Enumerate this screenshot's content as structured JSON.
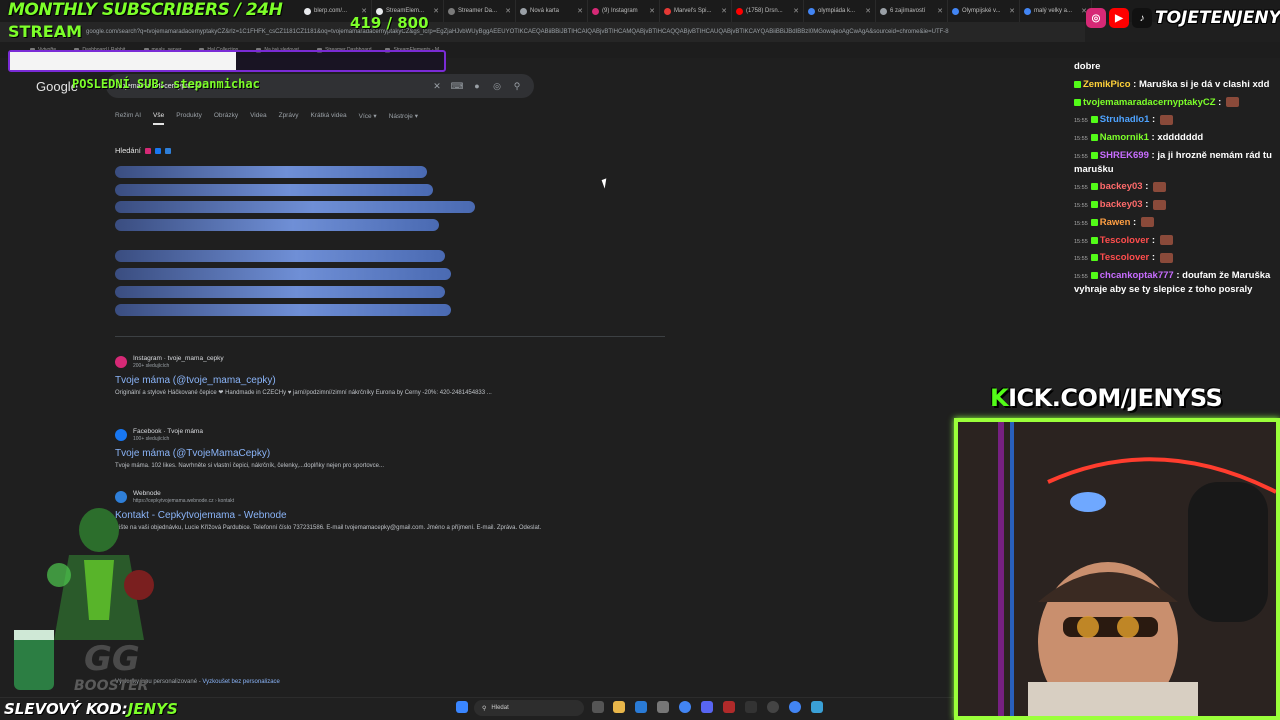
{
  "overlay": {
    "title": "MONTHLY SUBSCRIBERS / 24H",
    "stream": "STREAM",
    "count": "419  / 800",
    "progress_fraction": 0.52,
    "last_sub": "POSLEDNÍ SUB:  stepanmichac",
    "kick": "ICK.COM/JENYSS",
    "kick_k": "K",
    "handle": "TOJETENJENYS",
    "coupon_label": "SLEVOVÝ KOD:",
    "coupon_code": "JENYS"
  },
  "browser": {
    "tabs": [
      {
        "label": "blerp.com/...",
        "color": "#e8eaed"
      },
      {
        "label": "StreamElem...",
        "color": "#e8eaed"
      },
      {
        "label": "Streamer Da...",
        "color": "#7a7a7a"
      },
      {
        "label": "Nová karta",
        "color": "#9aa0a6"
      },
      {
        "label": "(9) Instagram",
        "color": "#d62976"
      },
      {
        "label": "Marvel's Spi...",
        "color": "#e53935"
      },
      {
        "label": "(1758) Drsn...",
        "color": "#ff0000"
      },
      {
        "label": "olympiáda k...",
        "color": "#4285f4"
      },
      {
        "label": "6 zajímavostí",
        "color": "#9aa0a6"
      },
      {
        "label": "Olympijské v...",
        "color": "#4285f4"
      },
      {
        "label": "malý velky a...",
        "color": "#4285f4"
      }
    ],
    "url": "google.com/search?q=tvojemamaradacernyptakyCZ&rlz=1C1FHFK_csCZ1181CZ1181&oq=tvojemamaradacernyptakyCZ&gs_lcrp=EgZjaHJvbWUyBggAEEUYOTIKCAEQABiiBBiJBTIHCAIQABjvBTIHCAMQABjvBTIHCAQQABjvBTIHCAUQABjvBTIKCAYQABiiBBiJBdIBBzI0MGowajeoAgCwAgA&sourceid=chrome&ie=UTF-8",
    "bookmarks": [
      "Vytvořte...",
      "Dashboard | Rabbit...",
      "meals_server...",
      "Hal Collection...",
      "Na tvé sledovat...",
      "Streamer Dashboard",
      "StreamElements - M..."
    ]
  },
  "google": {
    "logo": "Google",
    "query": "tvojemamaradacernyptakyCZ",
    "nav": [
      "Režim AI",
      "Vše",
      "Produkty",
      "Obrázky",
      "Videa",
      "Zprávy",
      "Krátká videa",
      "Více ▾",
      "Nástroje ▾"
    ],
    "active_nav": 1,
    "section": "Hledání",
    "skeleton_top": [
      0.52,
      0.53,
      0.6,
      0.54,
      0.55,
      0.56,
      0.55,
      0.56
    ],
    "results": [
      {
        "site": "Instagram · tvoje_mama_cepky",
        "meta": "200+ sledujících",
        "title": "Tvoje máma (@tvoje_mama_cepky)",
        "snippet": "Originální a stylové Háčkované čepice ❤ Handmade in CZECHy ♥ jarní/podzimní/zimní nákrčníky Eurona by Cerny -20%: 420-2481454833 ...",
        "fav": "#d62976"
      },
      {
        "site": "Facebook · Tvoje máma",
        "meta": "100+ sledujících",
        "title": "Tvoje máma (@TvojeMamaCepky)",
        "snippet": "Tvoje máma. 102 likes. Navrhněte si vlastní čepici, nákrčník, čelenky,...doplňky nejen pro sportovce...",
        "fav": "#1877f2"
      },
      {
        "site": "Webnode",
        "meta": "https://cepkytvojemama.webnode.cz › kontakt",
        "title": "Kontakt - Cepkytvojemama - Webnode",
        "snippet": "Pište na vaši objednávku, Lucie Křížová Pardubice. Telefonní číslo 737231586. E-mail tvojemamacepky@gmail.com. Jméno a příjmení. E-mail. Zpráva. Odeslat.",
        "fav": "#2f7fd8"
      }
    ],
    "personal_text": "Výsledky jsou personalizované - ",
    "personal_link": "Vyzkoušet bez personalizace"
  },
  "taskbar": {
    "search": "Hledat"
  },
  "chat": [
    {
      "ts": "",
      "user": "",
      "color": "#ffffff",
      "text": "dobre"
    },
    {
      "ts": "",
      "user": "ZemikPico",
      "color": "#ffd23a",
      "text": "Maruška si je dá v clashi xdd"
    },
    {
      "ts": "",
      "user": "tvojemamaradacernyptakyCZ",
      "color": "#7dff2a",
      "text": ""
    },
    {
      "ts": "15:55",
      "user": "Struhadlo1",
      "color": "#4ea3ff",
      "text": ""
    },
    {
      "ts": "15:55",
      "user": "Namornik1",
      "color": "#7dff2a",
      "text": "xddddddd"
    },
    {
      "ts": "15:55",
      "user": "SHREK699",
      "color": "#c86dff",
      "text": "ja ji hrozně nemám rád tu marušku"
    },
    {
      "ts": "15:55",
      "user": "backey03",
      "color": "#ff6b6b",
      "text": ""
    },
    {
      "ts": "15:55",
      "user": "backey03",
      "color": "#ff6b6b",
      "text": ""
    },
    {
      "ts": "15:55",
      "user": "Rawen",
      "color": "#ff9f43",
      "text": ""
    },
    {
      "ts": "15:55",
      "user": "Tescolover",
      "color": "#ff4d4d",
      "text": ""
    },
    {
      "ts": "15:55",
      "user": "Tescolover",
      "color": "#ff4d4d",
      "text": ""
    },
    {
      "ts": "15:55",
      "user": "chcankoptak777",
      "color": "#c86dff",
      "text": "doufam že Maruška vyhraje aby se ty slepice z toho posraly"
    }
  ]
}
